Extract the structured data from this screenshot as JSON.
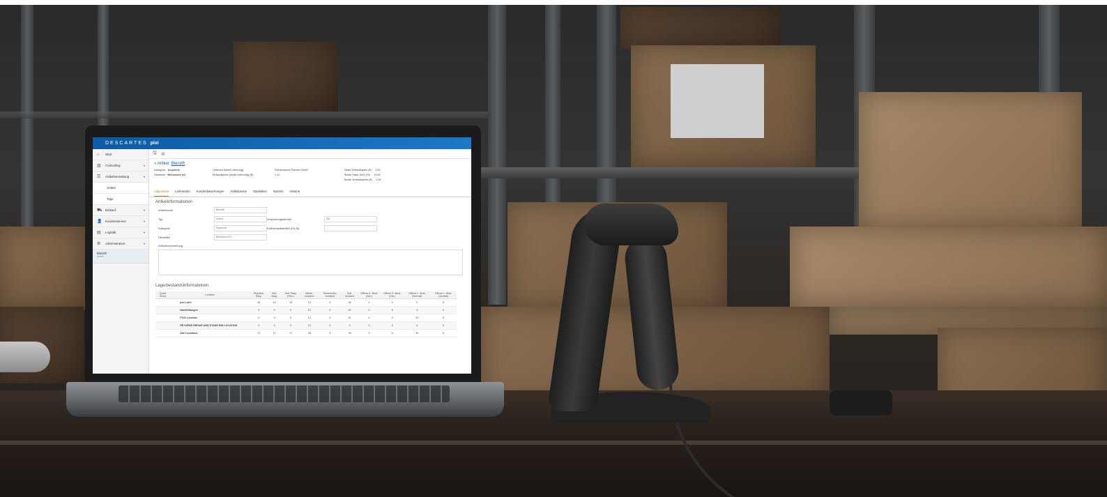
{
  "app": {
    "brand_prefix": "DESCARTES",
    "brand_suffix": "pixi",
    "accent_color": "#1469b8",
    "tab_active_color": "#d0782a"
  },
  "sidebar": {
    "items": [
      {
        "label": "Start",
        "icon": "home-icon"
      },
      {
        "label": "Controlling",
        "icon": "chart-icon"
      },
      {
        "label": "Artikelverwaltung",
        "icon": "list-icon"
      },
      {
        "label": "Artikel",
        "icon": ""
      },
      {
        "label": "Tags",
        "icon": ""
      },
      {
        "label": "Einkauf",
        "icon": "cart-icon"
      },
      {
        "label": "Kundenservice",
        "icon": "user-icon"
      },
      {
        "label": "Logistik",
        "icon": "truck-icon"
      },
      {
        "label": "Administration",
        "icon": "gear-icon"
      }
    ],
    "active": {
      "title": "Bleistift",
      "sub": "Artikel"
    }
  },
  "breadcrumb": {
    "prefix": "« Artikel:",
    "name": "Bleistift"
  },
  "header": {
    "rows": [
      [
        "Kategorie",
        "Angebote",
        "Lieferant (letzte Lieferung)",
        "Friedenswerk Panner GmbH",
        "Netto Verkaufspreis (€)",
        "1,26"
      ],
      [
        "Hersteller",
        "Bibliowerk AG",
        "Einkaufspreis (letzte Lieferung) (€)",
        "1,10",
        "Brutto Stats. EKG (%)",
        "19,00"
      ],
      [
        "",
        "",
        "",
        "",
        "Brutto Verkaufspreis (€)",
        "1,26"
      ]
    ]
  },
  "tabs": [
    "Allgemeine",
    "Lieferanten",
    "Kundenbewertungen",
    "Artikelpreise",
    "Statistiken",
    "Notizen",
    "Historie"
  ],
  "artikel_info": {
    "title": "Artikelinformationen",
    "fields": [
      {
        "label": "Artikelname",
        "value": "Bleistift"
      },
      {
        "label": "Typ",
        "value": "Artikel"
      },
      {
        "label": "Kategorie",
        "value": "Angebote"
      },
      {
        "label": "Hersteller",
        "value": "Bibliowerk AG"
      }
    ],
    "fields_right": [
      {
        "label": "Verpackungseinheit",
        "value": "Stk"
      },
      {
        "label": "Kaltverkaufsartikel (EI) (€)",
        "value": ""
      }
    ],
    "description_label": "Artikelbeschreibung"
  },
  "lager": {
    "title": "Lagerbestandsinformationen",
    "headers": [
      "Quick Stock",
      "Location",
      "Physikal. Bstg.",
      "Verf. Bstg.",
      "Verf. Bstg. (Res.)",
      "Melde-bestand",
      "Sicherheits-bestand",
      "Soll-bestand",
      "Offene K. Best. (Akt.)",
      "Offene K. Best. (Vrb.)",
      "Offene L. Best. (Normal)",
      "Offene L. Best. (Vorrats)"
    ],
    "rows": [
      [
        "",
        "pixi Lotte",
        "16",
        "10",
        "10",
        "12",
        "0",
        "38",
        "0",
        "0",
        "0",
        "0"
      ],
      [
        "",
        "Nachfüllungen",
        "0",
        "0",
        "0",
        "12",
        "0",
        "22",
        "0",
        "0",
        "0",
        "0"
      ],
      [
        "",
        "PCIS Location",
        "0",
        "0",
        "0",
        "12",
        "0",
        "22",
        "0",
        "0",
        "10",
        "0"
      ],
      [
        "",
        "RETURNS REPAIR AND STASH BIN LOCATION",
        "0",
        "0",
        "0",
        "12",
        "0",
        "0",
        "0",
        "0",
        "0",
        "0"
      ],
      [
        "",
        "Alle Locations",
        "17",
        "17",
        "17",
        "48",
        "0",
        "39",
        "0",
        "0",
        "34",
        "0"
      ]
    ]
  }
}
